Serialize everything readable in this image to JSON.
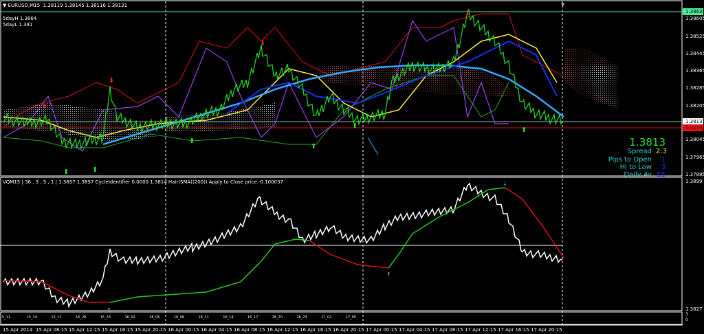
{
  "header": {
    "symbol": "EURUSD,M15",
    "ohlc": "1.38119 1.38145 1.38116 1.38131"
  },
  "five_day": {
    "high": "5dayH 1.3864",
    "low": "5dayL 1.381"
  },
  "price_axis": [
    "1.38605",
    "1.38525",
    "1.38445",
    "1.38365",
    "1.38285",
    "1.38205",
    "1.38045",
    "1.37965",
    "1.37885"
  ],
  "price_markers": {
    "top_line": "1.38635",
    "bid": "1.38131",
    "red_line": "1.38102"
  },
  "info_panel": {
    "price": "1.3813",
    "spread_label": "Spread",
    "spread_value": "2.3",
    "pips_label": "Pips to Open",
    "pips_value": "1",
    "hilo_label": "Hi to Low",
    "hilo_value": "3",
    "daily_label": "Daily Av",
    "daily_value": "55"
  },
  "indicator": {
    "header": "VQM15 | 36 , 3 , 5 , 1 | 1.3857 1.3857 CycleIdentifier 0.0000 1.3814 Hair(SMA((200)) Apply to Close price -0.100037",
    "axis_top": "1.3899",
    "axis_bottom": "1.3827"
  },
  "sub_strip": {
    "labels": [
      "5_11",
      "15_14",
      "15_17",
      "15_20",
      "15_23",
      "16_02",
      "16_05",
      "16_08",
      "16_11",
      "16_14",
      "16_17",
      "16_20",
      "16_23",
      "17_02",
      "17_05"
    ],
    "axis": [
      "3",
      "0"
    ]
  },
  "time_axis": [
    "15 Apr 2014",
    "15 Apr 08:15",
    "15 Apr 12:15",
    "15 Apr 16:15",
    "15 Apr 20:15",
    "16 Apr 00:15",
    "16 Apr 04:15",
    "16 Apr 08:15",
    "16 Apr 12:15",
    "16 Apr 16:15",
    "16 Apr 20:15",
    "17 Apr 00:15",
    "17 Apr 04:15",
    "17 Apr 08:15",
    "17 Apr 12:15",
    "17 Apr 16:15",
    "17 Apr 20:15"
  ],
  "colors": {
    "price": "#22dd22",
    "yellow": "#ffee44",
    "sma": "#33aaff",
    "purple": "#9944ee",
    "red": "#dd1111",
    "bid": "#ffffff",
    "green_line": "#44ee99"
  }
}
